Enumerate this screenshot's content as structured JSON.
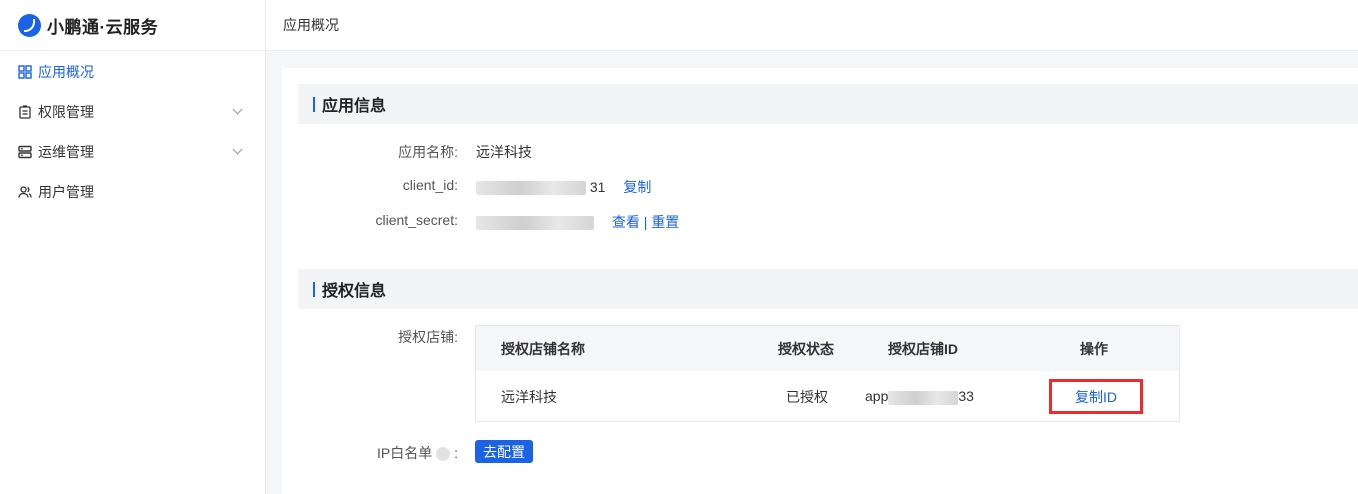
{
  "brand": {
    "name": "小鹏通·云服务"
  },
  "sidebar": {
    "items": [
      {
        "label": "应用概况",
        "icon": "grid-icon",
        "active": true
      },
      {
        "label": "权限管理",
        "icon": "clipboard-icon",
        "expandable": true
      },
      {
        "label": "运维管理",
        "icon": "server-icon",
        "expandable": true
      },
      {
        "label": "用户管理",
        "icon": "users-icon"
      }
    ]
  },
  "header": {
    "breadcrumb": "应用概况"
  },
  "app_info": {
    "title": "应用信息",
    "name_label": "应用名称:",
    "name_value": "远洋科技",
    "client_id_label": "client_id:",
    "client_id_suffix": "31",
    "client_id_copy": "复制",
    "client_secret_label": "client_secret:",
    "client_secret_view": "查看",
    "client_secret_sep": "|",
    "client_secret_reset": "重置"
  },
  "auth_info": {
    "title": "授权信息",
    "shops_label": "授权店铺:",
    "columns": [
      "授权店铺名称",
      "授权状态",
      "授权店铺ID",
      "操作"
    ],
    "rows": [
      {
        "name": "远洋科技",
        "status": "已授权",
        "id_prefix": "app",
        "id_suffix": "33",
        "action": "复制ID"
      }
    ],
    "ip_label": "IP白名单",
    "ip_colon": ":",
    "ip_button": "去配置"
  },
  "colors": {
    "accent": "#1a62e6",
    "highlight": "#ee2b2b"
  }
}
